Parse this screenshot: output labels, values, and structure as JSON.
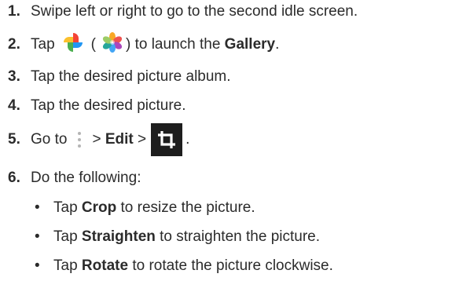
{
  "steps": [
    {
      "num": "1.",
      "text": "Swipe left or right to go to the second idle screen."
    },
    {
      "num": "2.",
      "pre": "Tap",
      "paren_open": "(",
      "mid": ") to launch the",
      "bold": "Gallery",
      "post": "."
    },
    {
      "num": "3.",
      "text": "Tap the desired picture album."
    },
    {
      "num": "4.",
      "text": "Tap the desired picture."
    },
    {
      "num": "5.",
      "pre": "Go to",
      "arrow1": "> ",
      "bold": "Edit",
      "arrow2": " >",
      "post": "."
    },
    {
      "num": "6.",
      "text": "Do the following:"
    }
  ],
  "bullets": [
    {
      "mark": "•",
      "pre": "Tap",
      "bold": "Crop",
      "post": "to resize the picture."
    },
    {
      "mark": "•",
      "pre": "Tap",
      "bold": "Straighten",
      "post": "to straighten the picture."
    },
    {
      "mark": "•",
      "pre": "Tap",
      "bold": "Rotate",
      "post": "to rotate the picture clockwise."
    }
  ],
  "icons": {
    "photos": "google-photos-pinwheel-icon",
    "gallery": "gallery-flower-icon",
    "menu": "more-options-vertical-dots-icon",
    "crop": "crop-icon"
  }
}
